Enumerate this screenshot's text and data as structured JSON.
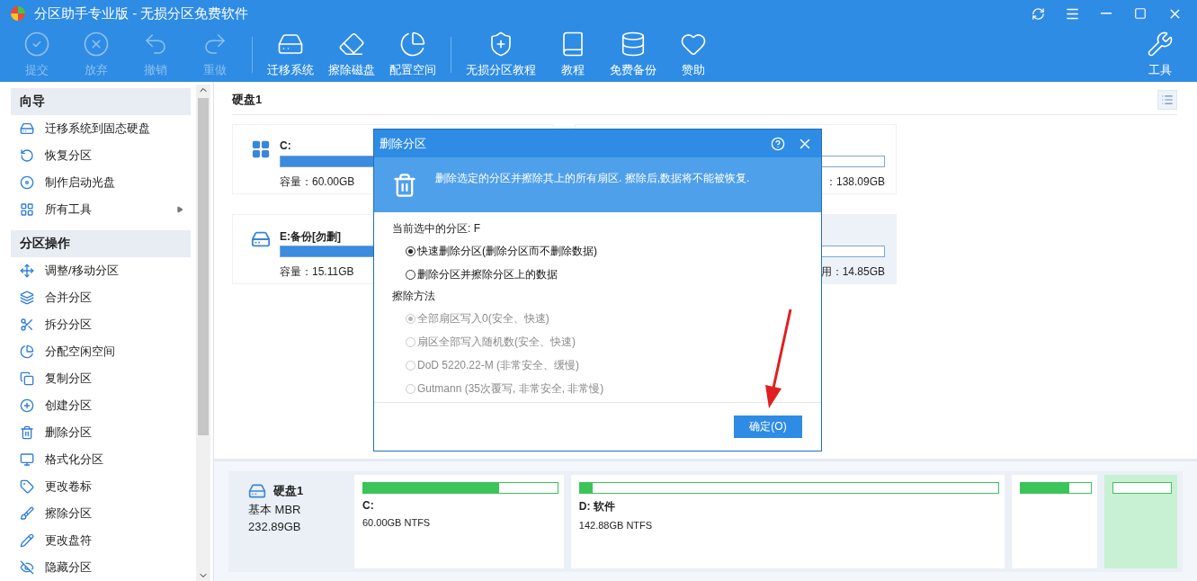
{
  "window": {
    "title": "分区助手专业版 - 无损分区免费软件"
  },
  "toolbar": {
    "groups": [
      [
        {
          "label": "提交",
          "disabled": true
        },
        {
          "label": "放弃",
          "disabled": true
        },
        {
          "label": "撤销",
          "disabled": true
        },
        {
          "label": "重做",
          "disabled": true
        }
      ],
      [
        {
          "label": "迁移系统",
          "disabled": false
        },
        {
          "label": "擦除磁盘",
          "disabled": false
        },
        {
          "label": "配置空间",
          "disabled": false
        }
      ],
      [
        {
          "label": "无损分区教程",
          "disabled": false
        },
        {
          "label": "教程",
          "disabled": false
        },
        {
          "label": "免费备份",
          "disabled": false
        },
        {
          "label": "赞助",
          "disabled": false
        }
      ]
    ],
    "tools": {
      "label": "工具"
    }
  },
  "sidebar": {
    "sections": [
      {
        "title": "向导",
        "items": [
          {
            "label": "迁移系统到固态硬盘",
            "has_submenu": false
          },
          {
            "label": "恢复分区",
            "has_submenu": false
          },
          {
            "label": "制作启动光盘",
            "has_submenu": false
          },
          {
            "label": "所有工具",
            "has_submenu": true
          }
        ]
      },
      {
        "title": "分区操作",
        "items": [
          {
            "label": "调整/移动分区",
            "has_submenu": false
          },
          {
            "label": "合并分区",
            "has_submenu": false
          },
          {
            "label": "拆分分区",
            "has_submenu": false
          },
          {
            "label": "分配空闲空间",
            "has_submenu": false
          },
          {
            "label": "复制分区",
            "has_submenu": false
          },
          {
            "label": "创建分区",
            "has_submenu": false
          },
          {
            "label": "删除分区",
            "has_submenu": false
          },
          {
            "label": "格式化分区",
            "has_submenu": false
          },
          {
            "label": "更改卷标",
            "has_submenu": false
          },
          {
            "label": "擦除分区",
            "has_submenu": false
          },
          {
            "label": "更改盘符",
            "has_submenu": false
          },
          {
            "label": "隐藏分区",
            "has_submenu": false
          }
        ]
      }
    ]
  },
  "disk": {
    "title": "硬盘1",
    "partitions": [
      {
        "kind": "full",
        "name": "C:",
        "detail": "容量：60.00GB",
        "level": 0.6,
        "selected": false
      },
      {
        "kind": "covered",
        "detail": "：138.09GB",
        "level": 0.02,
        "selected": false
      },
      {
        "kind": "full",
        "name": "E:备份[勿删]",
        "detail": "容量：15.11GB",
        "level": 0.6,
        "selected": false
      },
      {
        "kind": "covered",
        "detail": "用：14.85GB",
        "level": 0.02,
        "selected": true
      }
    ]
  },
  "disk_map": {
    "name": "硬盘1",
    "type": "基本 MBR",
    "size": "232.89GB",
    "partitions": [
      {
        "name": "C:",
        "detail": "60.00GB NTFS",
        "level": 0.7,
        "selected": false
      },
      {
        "name": "D: 软件",
        "detail": "142.88GB NTFS",
        "level": 0.03,
        "selected": false
      },
      {
        "level": 0.7,
        "selected": false
      },
      {
        "selected": true
      }
    ]
  },
  "dialog": {
    "title": "删除分区",
    "message": "删除选定的分区并擦除其上的所有扇区. 擦除后,数据将不能被恢复.",
    "current_label": "当前选中的分区: F",
    "options": [
      {
        "label": "快速删除分区(删除分区而不删除数据)",
        "selected": true
      },
      {
        "label": "删除分区并擦除分区上的数据",
        "selected": false
      }
    ],
    "wipe_title": "擦除方法",
    "wipe_methods": [
      {
        "label": "全部扇区写入0(安全、快速)",
        "selected": true,
        "disabled": true
      },
      {
        "label": "扇区全部写入随机数(安全、快速)",
        "selected": false,
        "disabled": true
      },
      {
        "label": "DoD 5220.22-M (非常安全、缓慢)",
        "selected": false,
        "disabled": true
      },
      {
        "label": "Gutmann (35次覆写, 非常安全, 非常慢)",
        "selected": false,
        "disabled": true
      }
    ],
    "ok_button": "确定(O)"
  }
}
